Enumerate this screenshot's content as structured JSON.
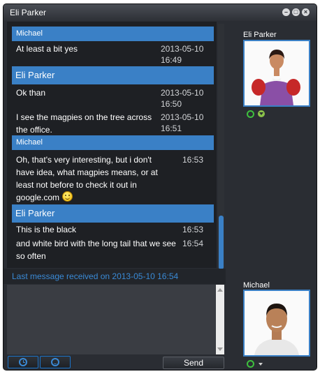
{
  "window": {
    "title": "Eli Parker"
  },
  "conversation": [
    {
      "author": "Michael",
      "header_style": "small",
      "text": "At least a bit yes",
      "time": "2013-05-10 16:49"
    },
    {
      "author": "Eli Parker",
      "header_style": "big",
      "text": "Ok than",
      "time": "2013-05-10 16:50"
    },
    {
      "author": "Eli Parker",
      "header_style": "none",
      "text": "I see the magpies on the tree across the office.",
      "time": "2013-05-10 16:51"
    },
    {
      "author": "Michael",
      "header_style": "small",
      "text": "Oh, that's very interesting, but i don't have idea, what magpies means, or at least not before to check it out in google.com",
      "time": "16:53",
      "emoticon": "smiley"
    },
    {
      "author": "Eli Parker",
      "header_style": "big",
      "text": "This is the black",
      "time": "16:53"
    },
    {
      "author": "Eli Parker",
      "header_style": "none",
      "text": "and white bird with the long tail that we see so often",
      "time": "16:54"
    }
  ],
  "status": {
    "last_message": "Last message received on 2013-05-10 16:54"
  },
  "toolbar": {
    "history_icon": "clock-icon",
    "emoticon_icon": "smiley-icon",
    "send_label": "Send"
  },
  "participants": [
    {
      "name": "Eli Parker",
      "presence": "online"
    },
    {
      "name": "Michael",
      "presence": "online"
    }
  ],
  "colors": {
    "accent": "#3a80c6",
    "status_text": "#3a8ad6",
    "online": "#3ec13e",
    "background": "#2a2d33"
  }
}
